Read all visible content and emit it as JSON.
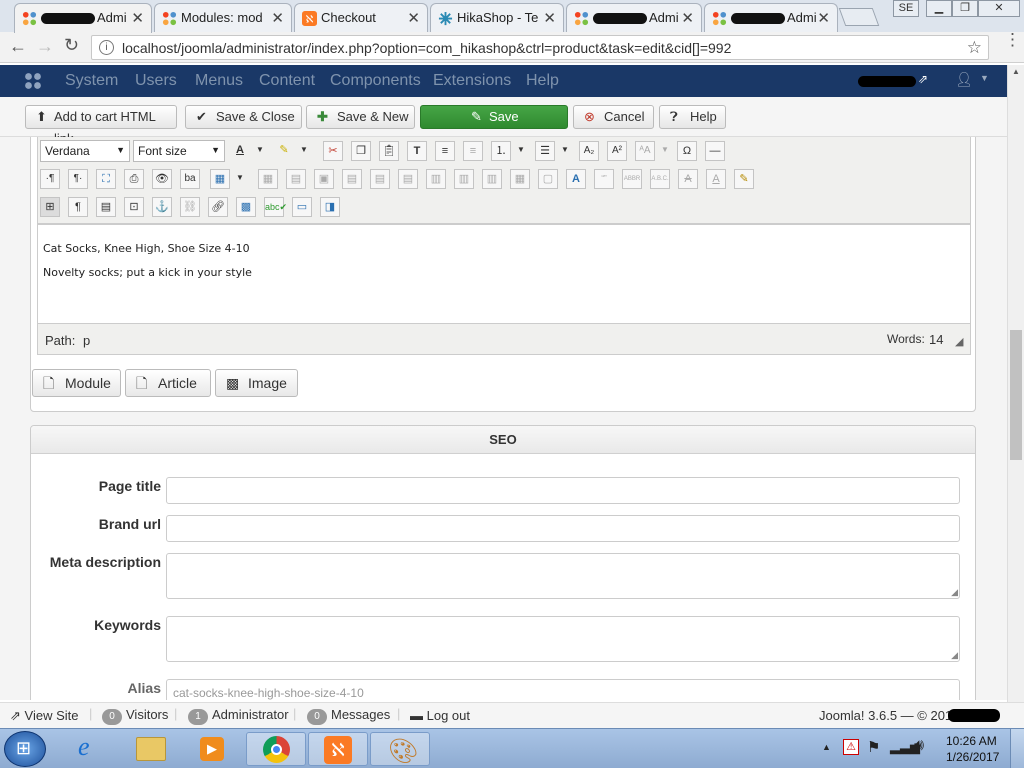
{
  "browser": {
    "tabs": [
      {
        "title": "Admi",
        "redacted": true,
        "active": true
      },
      {
        "title": "Modules: mod",
        "redacted": false
      },
      {
        "title": "Checkout",
        "redacted": false
      },
      {
        "title": "HikaShop - Te",
        "redacted": false
      },
      {
        "title": "Admi",
        "redacted": true
      },
      {
        "title": "Admi",
        "redacted": true
      }
    ],
    "profile_badge": "SE",
    "url": "localhost/joomla/administrator/index.php?option=com_hikashop&ctrl=product&task=edit&cid[]=992"
  },
  "joomla_menu": [
    "System",
    "Users",
    "Menus",
    "Content",
    "Components",
    "Extensions",
    "Help"
  ],
  "toolbar": {
    "add_to_cart": "Add to cart HTML link",
    "save_close": "Save & Close",
    "save_new": "Save & New",
    "save": "Save",
    "cancel": "Cancel",
    "help": "Help"
  },
  "editor": {
    "font_family": "Verdana",
    "font_size": "Font size",
    "content_line1": "Cat Socks, Knee High, Shoe Size 4-10",
    "content_line2": "Novelty socks; put a kick in your style",
    "path_label": "Path:",
    "path_value": "p",
    "words_label": "Words:",
    "words_count": "14",
    "buttons": {
      "module": "Module",
      "article": "Article",
      "image": "Image"
    }
  },
  "seo": {
    "heading": "SEO",
    "page_title_label": "Page title",
    "brand_url_label": "Brand url",
    "meta_description_label": "Meta description",
    "keywords_label": "Keywords",
    "alias_label": "Alias",
    "alias_value": "cat-socks-knee-high-shoe-size-4-10"
  },
  "statusbar": {
    "view_site": "View Site",
    "visitors_count": "0",
    "visitors": "Visitors",
    "administrator_count": "1",
    "administrator": "Administrator",
    "messages_count": "0",
    "messages": "Messages",
    "logout": "Log out",
    "version": "Joomla! 3.6.5 — © 201"
  },
  "taskbar": {
    "time": "10:26 AM",
    "date": "1/26/2017"
  },
  "colors": {
    "joomla_bar": "#1a3867",
    "save_green": "#3c9a3c",
    "taskbar": "#a9c4e6"
  }
}
